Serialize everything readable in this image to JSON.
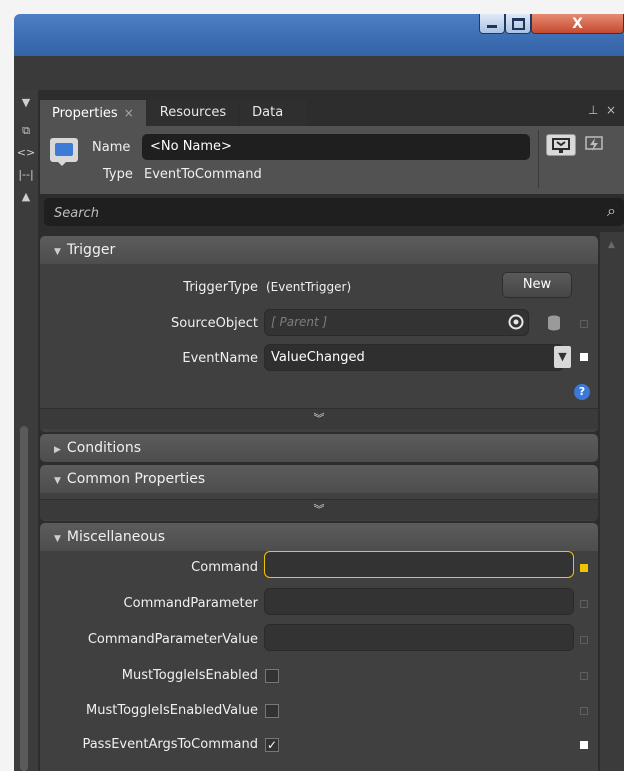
{
  "window": {
    "min_icon": "minimize-icon",
    "max_icon": "maximize-icon",
    "close_glyph": "X"
  },
  "tabs": [
    {
      "label": "Properties",
      "close": "×"
    },
    {
      "label": "Resources"
    },
    {
      "label": "Data"
    }
  ],
  "panel_buttons": {
    "pin": "⊥",
    "close": "×"
  },
  "header": {
    "name_label": "Name",
    "name_value": "<No Name>",
    "type_label": "Type",
    "type_value": "EventToCommand"
  },
  "search": {
    "placeholder": "Search",
    "icon": "search-icon"
  },
  "trigger": {
    "title": "Trigger",
    "trigger_type_label": "TriggerType",
    "trigger_type_value": "(EventTrigger)",
    "new_button": "New",
    "source_object_label": "SourceObject",
    "source_object_placeholder": "[ Parent ]",
    "event_name_label": "EventName",
    "event_name_value": "ValueChanged",
    "help": "?"
  },
  "conditions": {
    "title": "Conditions"
  },
  "common": {
    "title": "Common Properties"
  },
  "misc": {
    "title": "Miscellaneous",
    "command_label": "Command",
    "command_value": "",
    "command_parameter_label": "CommandParameter",
    "command_parameter_value_label": "CommandParameterValue",
    "must_toggle_label": "MustToggleIsEnabled",
    "must_toggle_checked": false,
    "must_toggle_value_label": "MustToggleIsEnabledValue",
    "must_toggle_value_checked": false,
    "pass_args_label": "PassEventArgsToCommand",
    "pass_args_checked": true,
    "check_glyph": "✓"
  },
  "colors": {
    "accent_gold": "#f0c400",
    "panel": "#404040",
    "titlebar": "#3c6db2"
  }
}
